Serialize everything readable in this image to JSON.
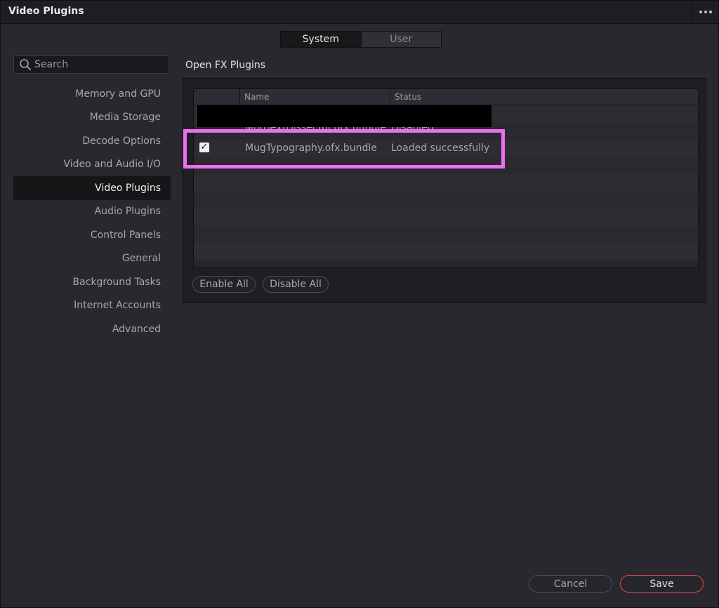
{
  "window": {
    "title": "Video Plugins",
    "more_icon": "more-horizontal-icon"
  },
  "tabs": [
    {
      "label": "System",
      "active": true
    },
    {
      "label": "User",
      "active": false
    }
  ],
  "search": {
    "placeholder": "Search",
    "value": "",
    "icon": "search-icon"
  },
  "sidebar": {
    "items": [
      {
        "label": "Memory and GPU",
        "active": false
      },
      {
        "label": "Media Storage",
        "active": false
      },
      {
        "label": "Decode Options",
        "active": false
      },
      {
        "label": "Video and Audio I/O",
        "active": false
      },
      {
        "label": "Video Plugins",
        "active": true
      },
      {
        "label": "Audio Plugins",
        "active": false
      },
      {
        "label": "Control Panels",
        "active": false
      },
      {
        "label": "General",
        "active": false
      },
      {
        "label": "Background Tasks",
        "active": false
      },
      {
        "label": "Internet Accounts",
        "active": false
      },
      {
        "label": "Advanced",
        "active": false
      }
    ]
  },
  "ofx": {
    "section_title": "Open FX Plugins",
    "columns": [
      "Name",
      "Status"
    ],
    "partial_row": {
      "name": "MugTextDissector.ofx.bundle",
      "status": "Disabled"
    },
    "rows": [
      {
        "checked": true,
        "name": "MugTypography.ofx.bundle",
        "status": "Loaded successfully"
      }
    ],
    "enable_all_label": "Enable All",
    "disable_all_label": "Disable All"
  },
  "footer": {
    "cancel_label": "Cancel",
    "save_label": "Save"
  },
  "colors": {
    "highlight": "#ee6df0",
    "save_border": "#d8484a",
    "background": "#28282e"
  }
}
